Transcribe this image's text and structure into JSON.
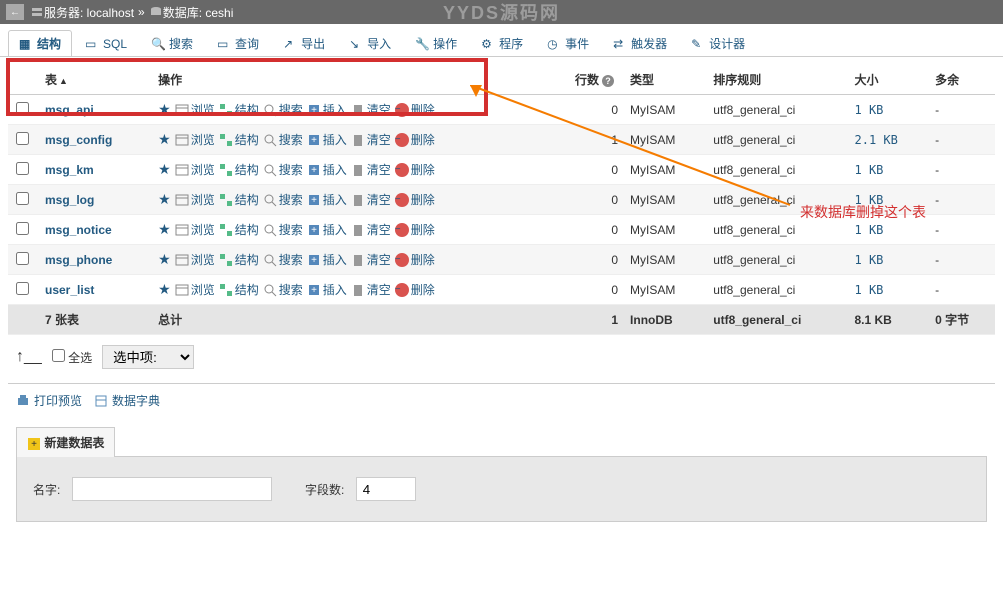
{
  "topbar": {
    "server_label": "服务器: localhost",
    "db_label": "数据库: ceshi",
    "sep": "»"
  },
  "watermark": "YYDS源码网",
  "tabs": [
    {
      "label": "结构",
      "active": true,
      "name": "structure"
    },
    {
      "label": "SQL",
      "name": "sql"
    },
    {
      "label": "搜索",
      "name": "search"
    },
    {
      "label": "查询",
      "name": "query"
    },
    {
      "label": "导出",
      "name": "export"
    },
    {
      "label": "导入",
      "name": "import"
    },
    {
      "label": "操作",
      "name": "operations"
    },
    {
      "label": "程序",
      "name": "routines"
    },
    {
      "label": "事件",
      "name": "events"
    },
    {
      "label": "触发器",
      "name": "triggers"
    },
    {
      "label": "设计器",
      "name": "designer"
    }
  ],
  "headers": {
    "table": "表",
    "ops": "操作",
    "rows": "行数",
    "type": "类型",
    "collation": "排序规则",
    "size": "大小",
    "overhead": "多余"
  },
  "op_labels": {
    "browse": "浏览",
    "structure": "结构",
    "search": "搜索",
    "insert": "插入",
    "empty": "清空",
    "drop": "删除"
  },
  "rows": [
    {
      "name": "msg_api",
      "rows": 0,
      "type": "MyISAM",
      "collation": "utf8_general_ci",
      "size": "1 KB",
      "overhead": "-"
    },
    {
      "name": "msg_config",
      "rows": 1,
      "type": "MyISAM",
      "collation": "utf8_general_ci",
      "size": "2.1 KB",
      "overhead": "-"
    },
    {
      "name": "msg_km",
      "rows": 0,
      "type": "MyISAM",
      "collation": "utf8_general_ci",
      "size": "1 KB",
      "overhead": "-"
    },
    {
      "name": "msg_log",
      "rows": 0,
      "type": "MyISAM",
      "collation": "utf8_general_ci",
      "size": "1 KB",
      "overhead": "-"
    },
    {
      "name": "msg_notice",
      "rows": 0,
      "type": "MyISAM",
      "collation": "utf8_general_ci",
      "size": "1 KB",
      "overhead": "-"
    },
    {
      "name": "msg_phone",
      "rows": 0,
      "type": "MyISAM",
      "collation": "utf8_general_ci",
      "size": "1 KB",
      "overhead": "-"
    },
    {
      "name": "user_list",
      "rows": 0,
      "type": "MyISAM",
      "collation": "utf8_general_ci",
      "size": "1 KB",
      "overhead": "-"
    }
  ],
  "summary": {
    "count": "7 张表",
    "total": "总计",
    "rows": 1,
    "type": "InnoDB",
    "collation": "utf8_general_ci",
    "size": "8.1 KB",
    "overhead": "0 字节"
  },
  "footer": {
    "check_all": "全选",
    "selected_label": "选中项:"
  },
  "links": {
    "print": "打印预览",
    "dict": "数据字典"
  },
  "create": {
    "title": "新建数据表",
    "name_label": "名字:",
    "cols_label": "字段数:",
    "cols_value": "4"
  },
  "annotation": "来数据库删掉这个表"
}
